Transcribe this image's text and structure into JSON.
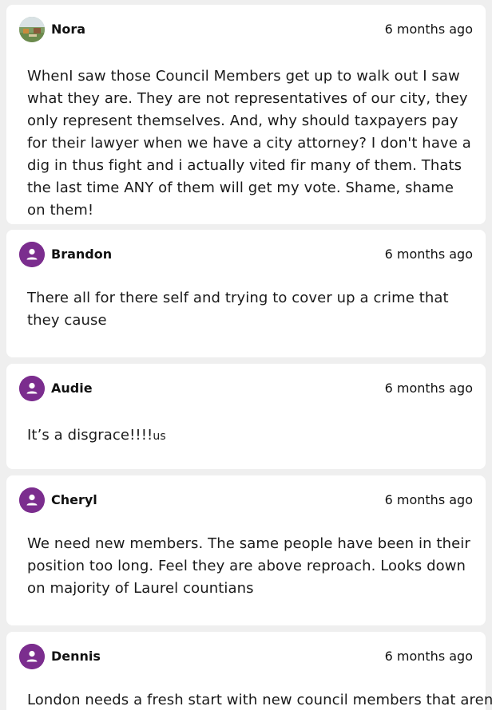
{
  "comments": [
    {
      "author": "Nora",
      "avatar_icon": "photo-avatar",
      "time": "6 months ago",
      "text": "WhenI saw those Council Members get up to walk out I saw what they are. They are not representatives of our city, they only represent themselves. And, why should taxpayers pay for their lawyer when we have a city attorney? I don't have a dig in thus fight and i actually vited fir many of them. Thats the last time ANY of them will get my vote. Shame, shame on them!"
    },
    {
      "author": "Brandon",
      "avatar_icon": "user-icon",
      "time": "6 months ago",
      "text": "There all for there self and trying to cover up a crime that they cause"
    },
    {
      "author": "Audie",
      "avatar_icon": "user-icon",
      "time": "6 months ago",
      "text": "It’s a disgrace!!!!",
      "text_suffix": "us"
    },
    {
      "author": "Cheryl",
      "avatar_icon": "user-icon",
      "time": "6 months ago",
      "text": "We need new members. The same people have been in their position too long. Feel they are above reproach. Looks down on majority of Laurel countians"
    },
    {
      "author": "Dennis",
      "avatar_icon": "user-icon",
      "time": "6 months ago",
      "text": "London needs a fresh start with new council members that aren't"
    }
  ],
  "colors": {
    "avatar_purple": "#7b2d8e",
    "card_bg": "#ffffff",
    "page_bg": "#efefef"
  }
}
